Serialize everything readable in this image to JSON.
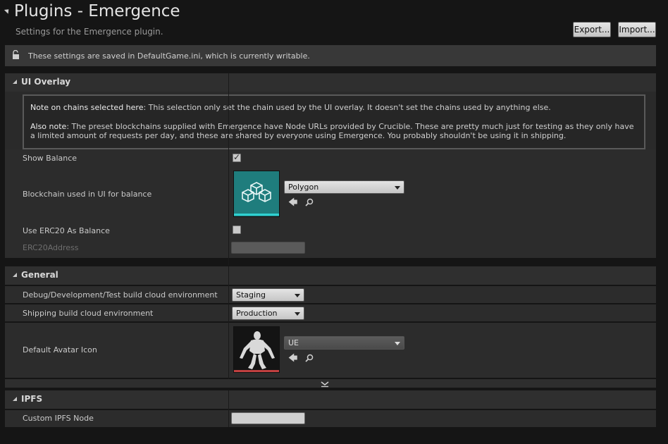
{
  "header": {
    "title": "Plugins - Emergence",
    "subtitle": "Settings for the Emergence plugin.",
    "export_label": "Export...",
    "import_label": "Import..."
  },
  "notice": {
    "text": "These settings are saved in DefaultGame.ini, which is currently writable.",
    "icon": "unlocked-icon"
  },
  "categories": {
    "ui_overlay": "UI Overlay",
    "general": "General",
    "ipfs": "IPFS"
  },
  "note": {
    "line1_bold": "Note on chains selected here",
    "line1_rest": ": This selection only set the chain used by the UI overlay. It doesn't set the chains used by anything else.",
    "line2_bold": "Also note",
    "line2_rest": ": The preset blockchains supplied with Emergence have Node URLs provided by Crucible. These are pretty much just for testing as they only have a limited amount of requests per day, and these are shared by everyone using Emergence. You probably shouldn't be using it in shipping."
  },
  "ui_overlay": {
    "show_balance_label": "Show Balance",
    "show_balance_checked": true,
    "blockchain_label": "Blockchain used in UI for balance",
    "blockchain_value": "Polygon",
    "use_erc20_label": "Use ERC20 As Balance",
    "use_erc20_checked": false,
    "erc20_address_label": "ERC20Address",
    "erc20_address_value": ""
  },
  "general": {
    "debug_env_label": "Debug/Development/Test build cloud environment",
    "debug_env_value": "Staging",
    "shipping_env_label": "Shipping build cloud environment",
    "shipping_env_value": "Production",
    "avatar_label": "Default Avatar Icon",
    "avatar_value": "UE"
  },
  "ipfs": {
    "custom_node_label": "Custom IPFS Node",
    "custom_node_value": ""
  },
  "colors": {
    "blockchain_thumb_bg": "#1f7d7d",
    "blockchain_thumb_bar": "#2fd0d0",
    "avatar_thumb_bar": "#c04040"
  }
}
